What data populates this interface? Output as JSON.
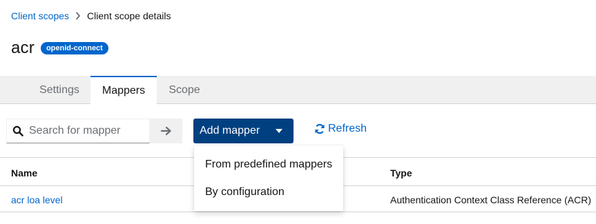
{
  "breadcrumb": {
    "parent": "Client scopes",
    "current": "Client scope details"
  },
  "scope": {
    "name": "acr",
    "protocol_badge": "openid-connect"
  },
  "tabs": [
    {
      "label": "Settings",
      "active": false
    },
    {
      "label": "Mappers",
      "active": true
    },
    {
      "label": "Scope",
      "active": false
    }
  ],
  "toolbar": {
    "search_placeholder": "Search for mapper",
    "add_mapper_label": "Add mapper",
    "refresh_label": "Refresh"
  },
  "dropdown": {
    "items": [
      "From predefined mappers",
      "By configuration"
    ]
  },
  "table": {
    "columns": [
      "Name",
      "Type"
    ],
    "rows": [
      {
        "name": "acr loa level",
        "type": "Authentication Context Class Reference (ACR)"
      }
    ]
  },
  "colors": {
    "link": "#0066cc",
    "primary_button": "#004080",
    "badge": "#0066cc"
  },
  "icons": [
    "chevron-right-icon",
    "search-icon",
    "arrow-right-icon",
    "caret-down-icon",
    "sync-icon"
  ]
}
